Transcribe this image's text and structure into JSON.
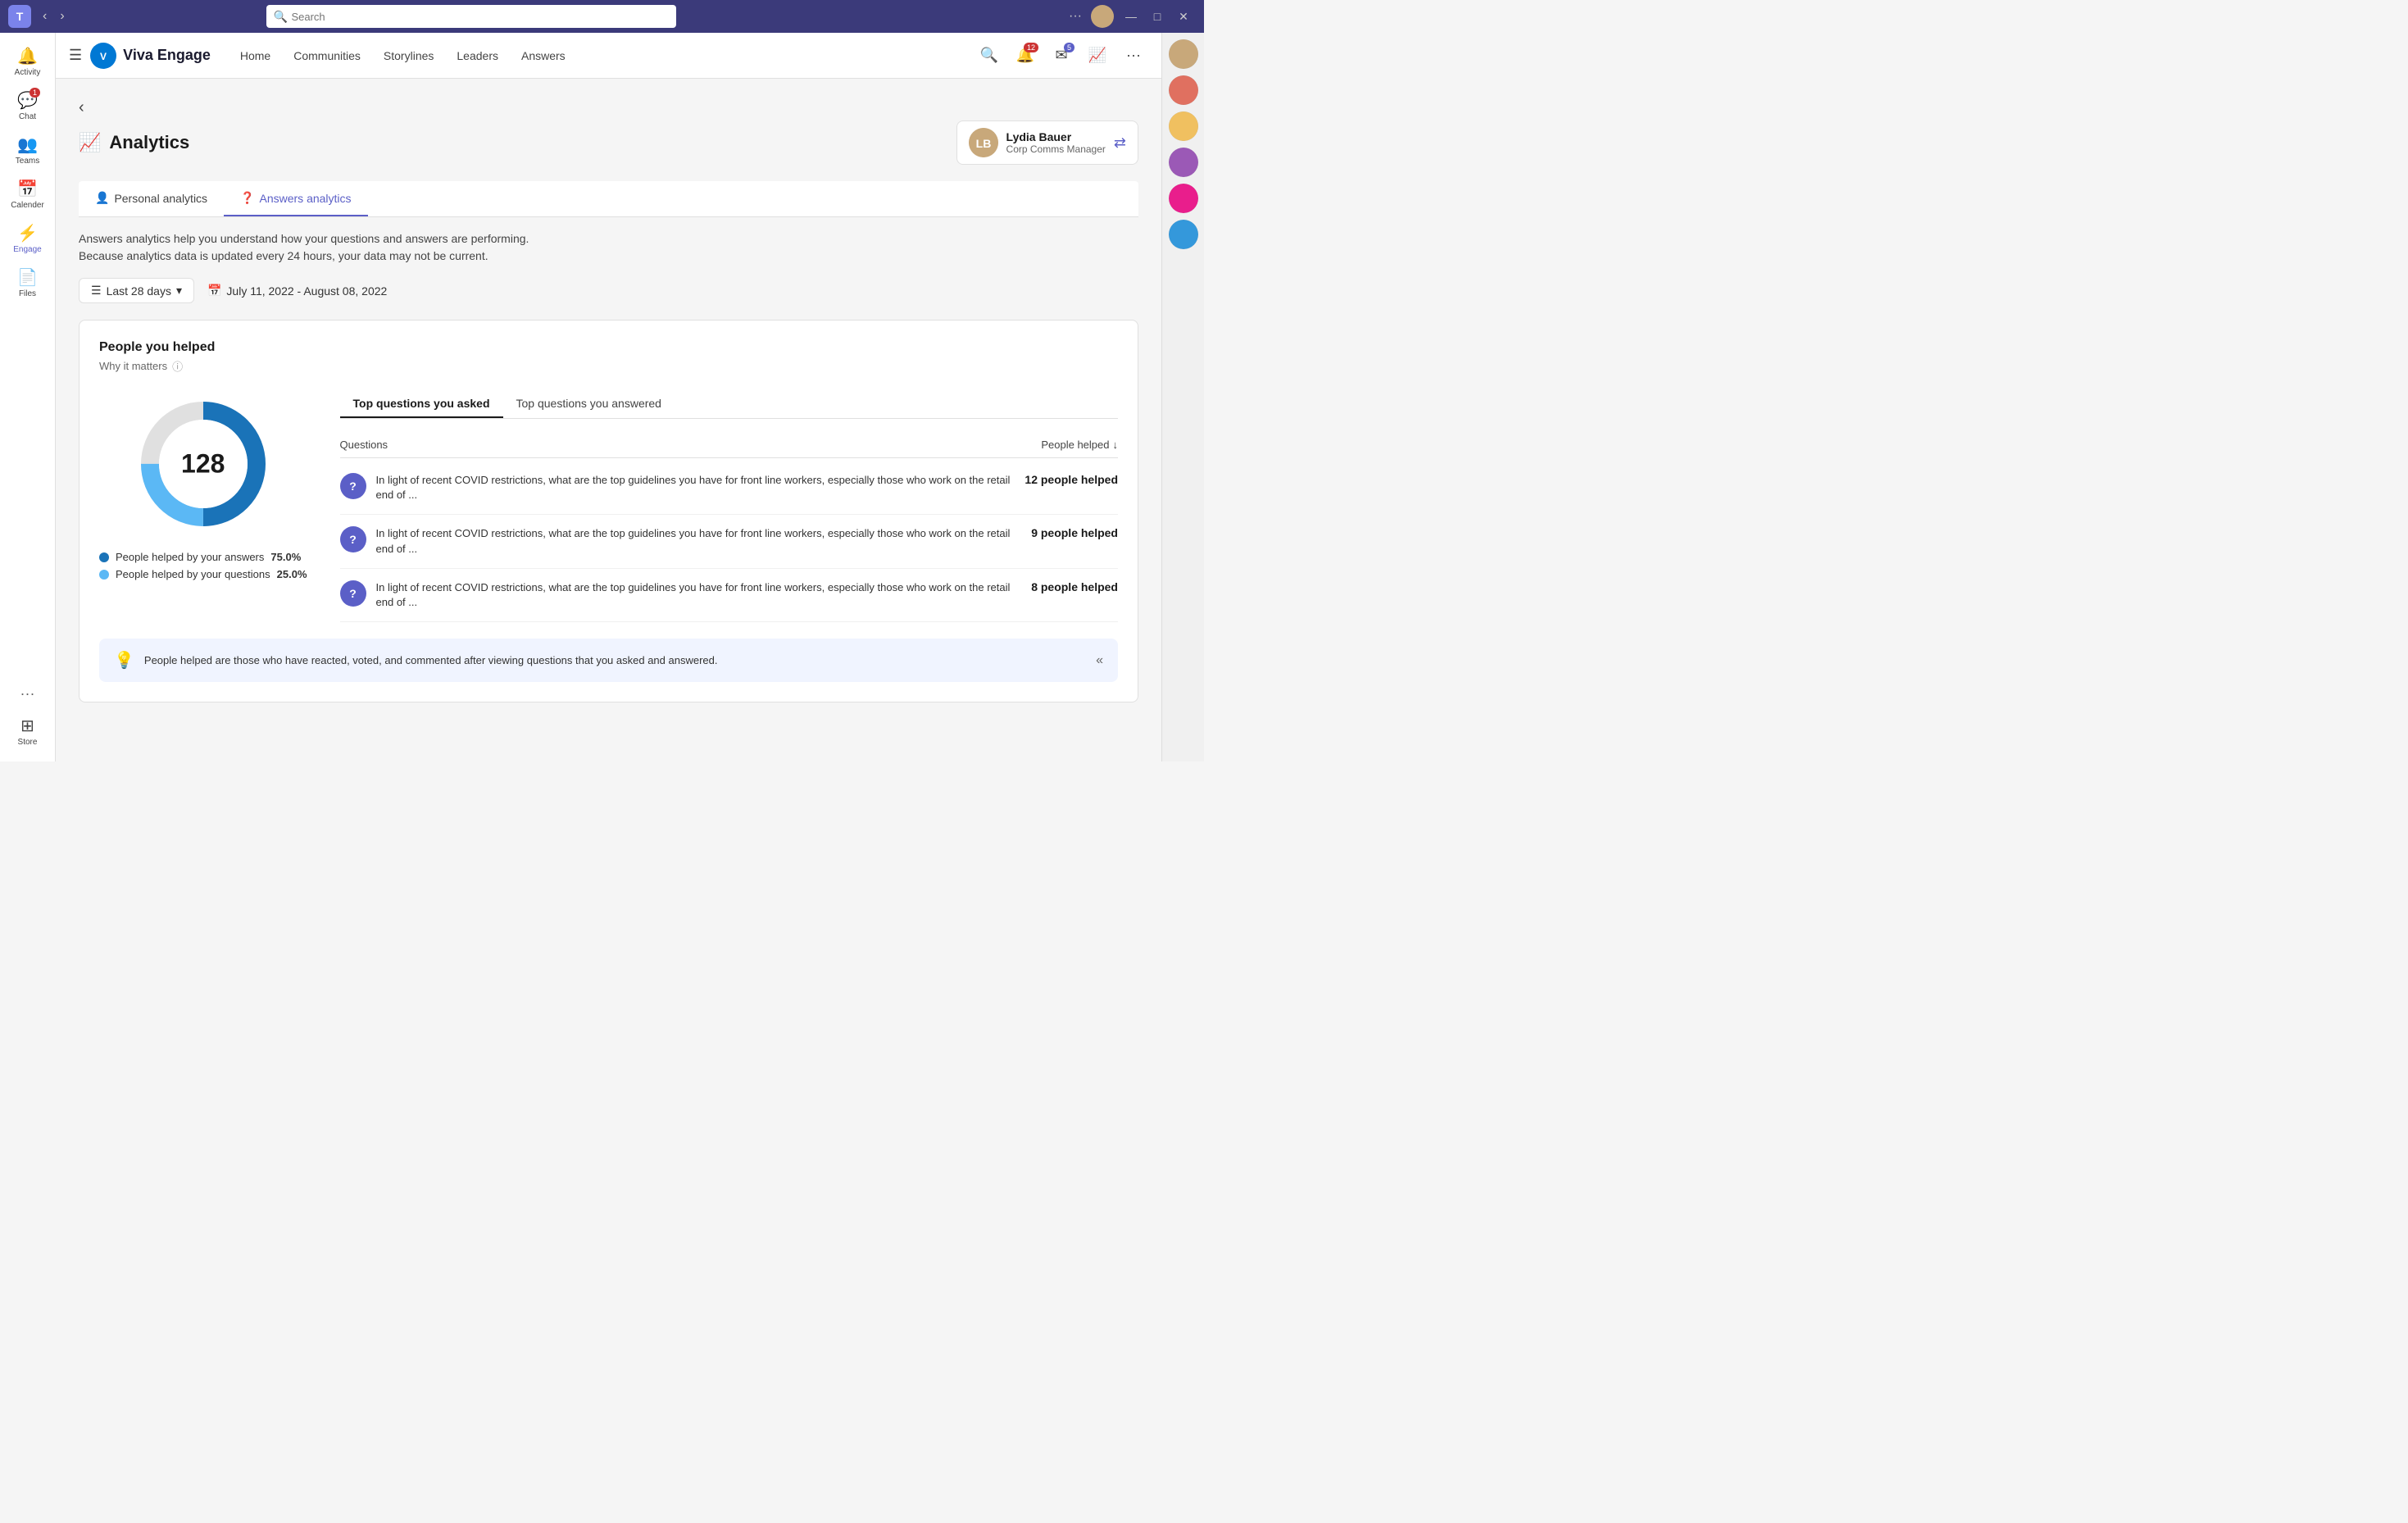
{
  "titleBar": {
    "logoText": "T",
    "searchPlaceholder": "Search",
    "moreLabel": "···",
    "minimizeLabel": "—",
    "maximizeLabel": "□",
    "closeLabel": "✕"
  },
  "sidebar": {
    "items": [
      {
        "id": "activity",
        "label": "Activity",
        "icon": "🔔",
        "badge": null,
        "active": false
      },
      {
        "id": "chat",
        "label": "Chat",
        "icon": "💬",
        "badge": "1",
        "active": false
      },
      {
        "id": "teams",
        "label": "Teams",
        "icon": "👥",
        "badge": null,
        "active": false
      },
      {
        "id": "calendar",
        "label": "Calender",
        "icon": "📅",
        "badge": null,
        "active": false
      },
      {
        "id": "engage",
        "label": "Engage",
        "icon": "⚡",
        "badge": null,
        "active": true
      },
      {
        "id": "files",
        "label": "Files",
        "icon": "📄",
        "badge": null,
        "active": false
      }
    ],
    "bottomItems": [
      {
        "id": "store",
        "label": "Store",
        "icon": "⊞",
        "badge": null
      }
    ],
    "moreLabel": "···"
  },
  "topNav": {
    "hamburgerLabel": "☰",
    "appName": "Viva Engage",
    "links": [
      {
        "id": "home",
        "label": "Home"
      },
      {
        "id": "communities",
        "label": "Communities"
      },
      {
        "id": "storylines",
        "label": "Storylines"
      },
      {
        "id": "leaders",
        "label": "Leaders"
      },
      {
        "id": "answers",
        "label": "Answers"
      }
    ],
    "searchIcon": "🔍",
    "notificationsIcon": "🔔",
    "notificationsBadge": "12",
    "messagesIcon": "✉",
    "messagesBadge": "5",
    "analyticsIcon": "📈",
    "moreIcon": "···"
  },
  "page": {
    "backLabel": "‹",
    "titleIcon": "📈",
    "titleText": "Analytics",
    "user": {
      "name": "Lydia Bauer",
      "role": "Corp Comms Manager",
      "switchIcon": "⇄"
    },
    "tabs": [
      {
        "id": "personal",
        "label": "Personal analytics",
        "active": false
      },
      {
        "id": "answers",
        "label": "Answers analytics",
        "active": true
      }
    ],
    "description": "Answers analytics help you understand how your questions and answers are performing.\nBecause analytics data is updated every 24 hours, your data may not be current.",
    "filters": {
      "periodLabel": "Last 28 days",
      "periodIcon": "▾",
      "dateRangeIcon": "📅",
      "dateRange": "July 11, 2022 - August 08, 2022"
    },
    "card": {
      "title": "People you helped",
      "subtitle": "Why it matters",
      "donut": {
        "total": 128,
        "segments": [
          {
            "label": "People helped by your answers",
            "value": 75.0,
            "color": "#1a73b8",
            "percent": 75
          },
          {
            "label": "People helped by your questions",
            "value": 25.0,
            "color": "#5bb8f5",
            "percent": 25
          }
        ]
      },
      "tableTabs": [
        {
          "id": "asked",
          "label": "Top questions you asked",
          "active": true
        },
        {
          "id": "answered",
          "label": "Top questions you answered",
          "active": false
        }
      ],
      "tableHeader": {
        "questionsLabel": "Questions",
        "peopleHelpedLabel": "People helped",
        "sortIcon": "↓"
      },
      "tableRows": [
        {
          "questionText": "In light of recent COVID restrictions, what are the top guidelines you have for front line workers, especially those who work on the retail end of ...",
          "peopleHelped": "12 people helped"
        },
        {
          "questionText": "In light of recent COVID restrictions, what are the top guidelines you have for front line workers, especially those who work on the retail end of ...",
          "peopleHelped": "9 people helped"
        },
        {
          "questionText": "In light of recent COVID restrictions, what are the top guidelines you have for front line workers, especially those who work on the retail end of ...",
          "peopleHelped": "8 people helped"
        }
      ]
    },
    "footerNote": "People helped are those who have reacted, voted, and commented after viewing questions that you asked and answered.",
    "collapseIcon": "«"
  },
  "rightPanel": {
    "avatars": [
      "#c8a87a",
      "#e07060",
      "#f0c060",
      "#9b59b6",
      "#e91e8c",
      "#3498db"
    ]
  }
}
